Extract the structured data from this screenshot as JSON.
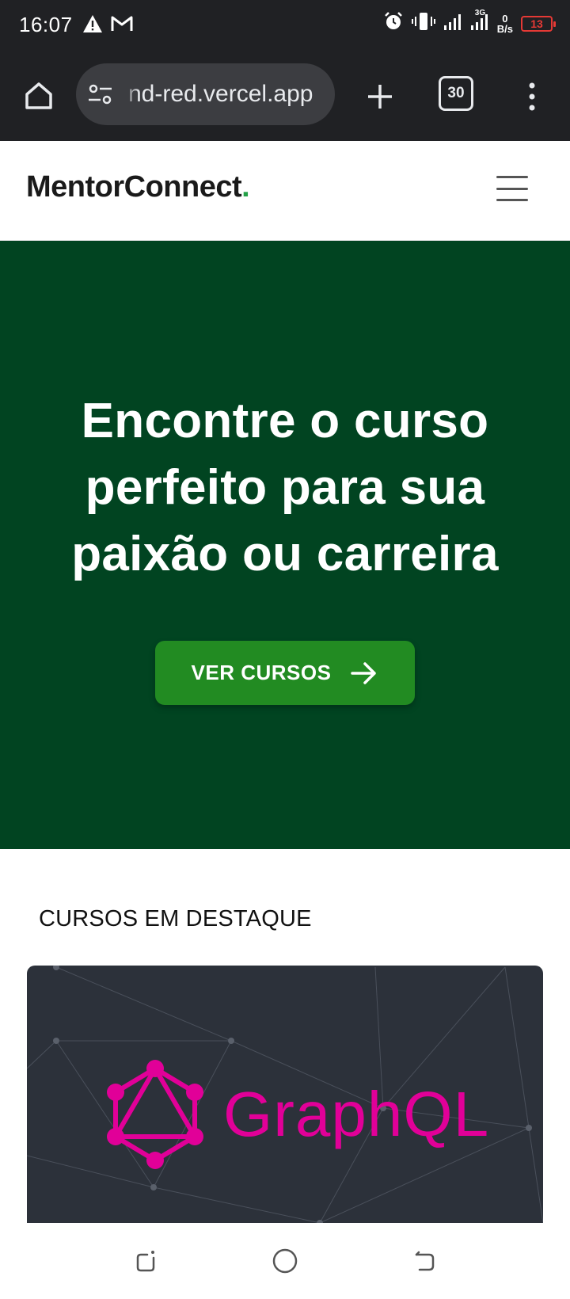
{
  "status_bar": {
    "time": "16:07",
    "network_type": "3G",
    "net_speed_value": "0",
    "net_speed_unit": "B/s",
    "battery": "13"
  },
  "browser": {
    "url": "nd-red.vercel.app",
    "tab_count": "30"
  },
  "site": {
    "brand": "MentorConnect",
    "brand_dot": ".",
    "brand_dot_color": "#24a148"
  },
  "hero": {
    "title": "Encontre o curso perfeito para sua paixão ou carreira",
    "cta_label": "VER CURSOS",
    "background_color": "#014421",
    "cta_color": "#228b22"
  },
  "featured": {
    "heading": "CURSOS EM DESTAQUE",
    "courses": [
      {
        "name": "GraphQL",
        "logo_color": "#e10098",
        "icon": "graphql-logo"
      }
    ]
  },
  "icons": [
    "alert-icon",
    "gmail-icon",
    "alarm-icon",
    "vibrate-icon",
    "signal-icon",
    "battery-icon",
    "home-icon",
    "tune-icon",
    "plus-icon",
    "tabs-icon",
    "more-vert-icon",
    "hamburger-menu-icon",
    "arrow-right-icon",
    "recent-apps-icon",
    "home-circle-icon",
    "back-icon"
  ]
}
